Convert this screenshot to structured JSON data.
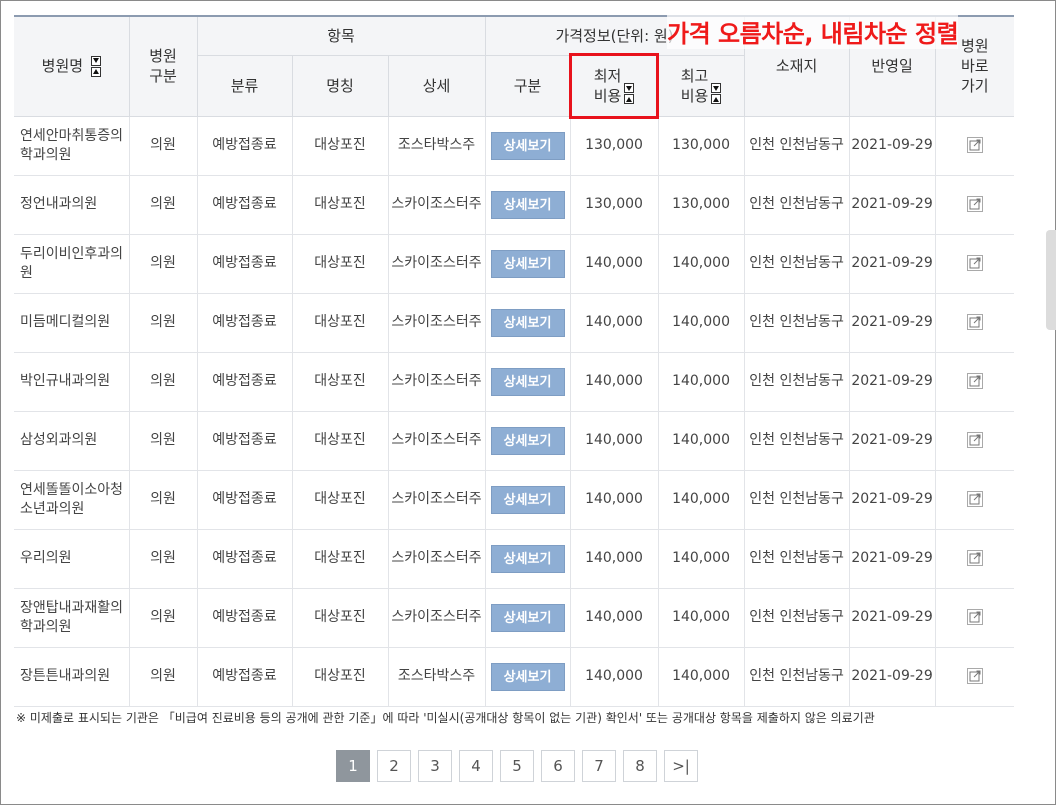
{
  "annotation": {
    "text": "가격 오름차순, 내림차순 정렬"
  },
  "header": {
    "hospital_name": "병원명",
    "hospital_type": "병원\n구분",
    "item_group": "항목",
    "price_group": "가격정보(단위: 원)",
    "category": "분류",
    "name": "명칭",
    "detail": "상세",
    "division": "구분",
    "min_price": "최저\n비용",
    "max_price": "최고\n비용",
    "location": "소재지",
    "reflected_date": "반영일",
    "shortcut": "병원\n바로\n가기"
  },
  "detail_button_label": "상세보기",
  "rows": [
    {
      "hospital": "연세안마취통증의학과의원",
      "type": "의원",
      "category": "예방접종료",
      "name": "대상포진",
      "detail": "조스타박스주",
      "min": "130,000",
      "max": "130,000",
      "location": "인천 인천남동구",
      "date": "2021-09-29"
    },
    {
      "hospital": "정언내과의원",
      "type": "의원",
      "category": "예방접종료",
      "name": "대상포진",
      "detail": "스카이조스터주",
      "min": "130,000",
      "max": "130,000",
      "location": "인천 인천남동구",
      "date": "2021-09-29"
    },
    {
      "hospital": "두리이비인후과의원",
      "type": "의원",
      "category": "예방접종료",
      "name": "대상포진",
      "detail": "스카이조스터주",
      "min": "140,000",
      "max": "140,000",
      "location": "인천 인천남동구",
      "date": "2021-09-29"
    },
    {
      "hospital": "미듬메디컬의원",
      "type": "의원",
      "category": "예방접종료",
      "name": "대상포진",
      "detail": "스카이조스터주",
      "min": "140,000",
      "max": "140,000",
      "location": "인천 인천남동구",
      "date": "2021-09-29"
    },
    {
      "hospital": "박인규내과의원",
      "type": "의원",
      "category": "예방접종료",
      "name": "대상포진",
      "detail": "스카이조스터주",
      "min": "140,000",
      "max": "140,000",
      "location": "인천 인천남동구",
      "date": "2021-09-29"
    },
    {
      "hospital": "삼성외과의원",
      "type": "의원",
      "category": "예방접종료",
      "name": "대상포진",
      "detail": "스카이조스터주",
      "min": "140,000",
      "max": "140,000",
      "location": "인천 인천남동구",
      "date": "2021-09-29"
    },
    {
      "hospital": "연세똘똘이소아청소년과의원",
      "type": "의원",
      "category": "예방접종료",
      "name": "대상포진",
      "detail": "스카이조스터주",
      "min": "140,000",
      "max": "140,000",
      "location": "인천 인천남동구",
      "date": "2021-09-29"
    },
    {
      "hospital": "우리의원",
      "type": "의원",
      "category": "예방접종료",
      "name": "대상포진",
      "detail": "스카이조스터주",
      "min": "140,000",
      "max": "140,000",
      "location": "인천 인천남동구",
      "date": "2021-09-29"
    },
    {
      "hospital": "장앤탑내과재활의학과의원",
      "type": "의원",
      "category": "예방접종료",
      "name": "대상포진",
      "detail": "스카이조스터주",
      "min": "140,000",
      "max": "140,000",
      "location": "인천 인천남동구",
      "date": "2021-09-29"
    },
    {
      "hospital": "장튼튼내과의원",
      "type": "의원",
      "category": "예방접종료",
      "name": "대상포진",
      "detail": "조스타박스주",
      "min": "140,000",
      "max": "140,000",
      "location": "인천 인천남동구",
      "date": "2021-09-29"
    }
  ],
  "footnote": "※ 미제출로 표시되는 기관은 「비급여 진료비용 등의 공개에 관한 기준」에 따라 '미실시(공개대상 항목이 없는 기관) 확인서' 또는 공개대상 항목을 제출하지 않은 의료기관",
  "pagination": {
    "pages": [
      "1",
      "2",
      "3",
      "4",
      "5",
      "6",
      "7",
      "8"
    ],
    "current": "1",
    "last_label": ">|"
  },
  "colors": {
    "annotation": "#ef1a1a",
    "detail_button": "#8eaed4",
    "active_page": "#8f969d"
  }
}
